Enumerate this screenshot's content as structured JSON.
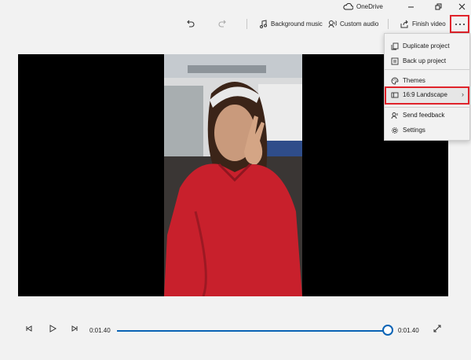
{
  "titlebar": {
    "onedrive_label": "OneDrive",
    "icons": [
      "cloud-icon",
      "minimize-icon",
      "restore-icon",
      "close-icon"
    ]
  },
  "toolbar": {
    "undo_icon": "undo-icon",
    "redo_icon": "redo-icon",
    "background_music_label": "Background music",
    "custom_audio_label": "Custom audio",
    "finish_video_label": "Finish video",
    "more_icon": "ellipsis-icon"
  },
  "menu": {
    "items": [
      {
        "label": "Duplicate project",
        "icon": "duplicate-icon"
      },
      {
        "label": "Back up project",
        "icon": "backup-icon"
      },
      {
        "label": "Themes",
        "icon": "palette-icon"
      },
      {
        "label": "16:9 Landscape",
        "icon": "aspect-ratio-icon",
        "has_submenu": true,
        "highlighted": true
      },
      {
        "label": "Send feedback",
        "icon": "feedback-icon"
      },
      {
        "label": "Settings",
        "icon": "gear-icon"
      }
    ]
  },
  "playback": {
    "current_time": "0:01.40",
    "total_time": "0:01.40",
    "progress": 1.0,
    "icons": [
      "previous-frame-icon",
      "play-icon",
      "next-frame-icon",
      "fullscreen-icon"
    ]
  },
  "colors": {
    "accent": "#0a63b5",
    "highlight_border": "#e0232b",
    "background": "#f2f2f2"
  }
}
